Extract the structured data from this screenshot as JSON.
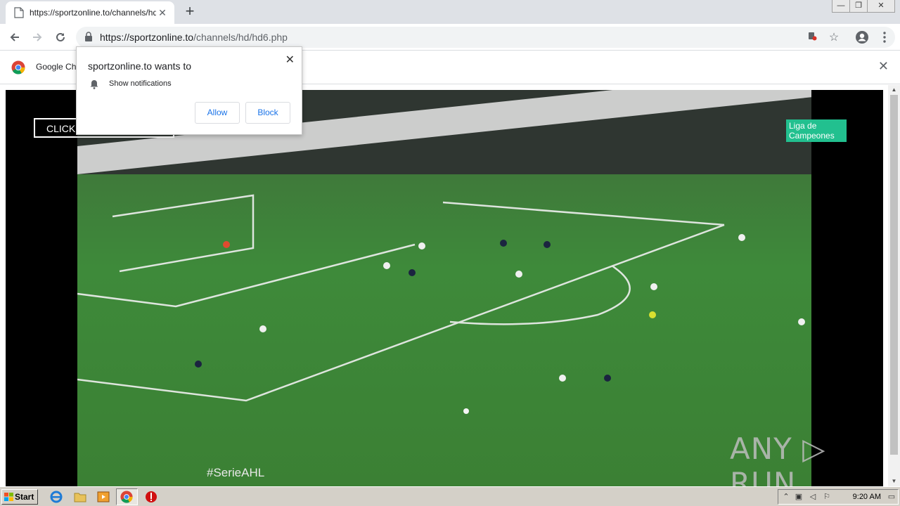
{
  "browser": {
    "tab_title": "https://sportzonline.to/channels/hd/",
    "tab_close": "✕",
    "new_tab": "+",
    "url_host": "https://sportzonline.to",
    "url_path": "/channels/hd/hd6.php"
  },
  "window_controls": {
    "minimize": "—",
    "restore": "❐",
    "close": "✕"
  },
  "infobar": {
    "text": "Google Ch",
    "close": "✕"
  },
  "popup": {
    "heading": "sportzonline.to wants to",
    "permission": "Show notifications",
    "allow_label": "Allow",
    "block_label": "Block",
    "close": "✕"
  },
  "page": {
    "click_label": "CLICK",
    "overlay_hashtag": "#SerieAHL",
    "tv_badge_line1": "Liga de",
    "tv_badge_line2": "Campeones",
    "watermark": "ANY ▷ RUN"
  },
  "taskbar": {
    "start_label": "Start",
    "clock": "9:20 AM"
  },
  "colors": {
    "accent": "#1a73e8",
    "tabstrip": "#dee1e6",
    "pitch": "#3e8a3a",
    "badge": "#22c08f"
  }
}
